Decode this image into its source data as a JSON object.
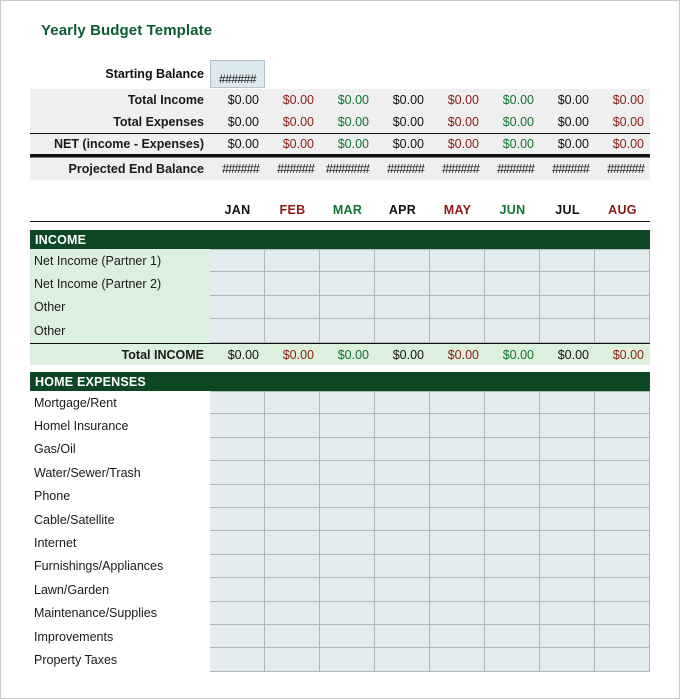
{
  "title": "Yearly Budget Template",
  "colors": {
    "title_green": "#0d5c33",
    "section_bar": "#0d4723",
    "entry_fill": "#e3ebef",
    "total_fill": "#ddf0dd",
    "summary_fill": "#efefef",
    "month_black": "#111111",
    "month_red": "#8c1b15",
    "month_green": "#117331"
  },
  "months": [
    {
      "label": "JAN",
      "tone": "black"
    },
    {
      "label": "FEB",
      "tone": "red"
    },
    {
      "label": "MAR",
      "tone": "green"
    },
    {
      "label": "APR",
      "tone": "black"
    },
    {
      "label": "MAY",
      "tone": "red"
    },
    {
      "label": "JUN",
      "tone": "green"
    },
    {
      "label": "JUL",
      "tone": "black"
    },
    {
      "label": "AUG",
      "tone": "red"
    }
  ],
  "starting_balance": {
    "label": "Starting Balance",
    "value": "######"
  },
  "summary": {
    "rows": [
      {
        "label": "Total Income",
        "values": [
          "$0.00",
          "$0.00",
          "$0.00",
          "$0.00",
          "$0.00",
          "$0.00",
          "$0.00",
          "$0.00"
        ]
      },
      {
        "label": "Total Expenses",
        "values": [
          "$0.00",
          "$0.00",
          "$0.00",
          "$0.00",
          "$0.00",
          "$0.00",
          "$0.00",
          "$0.00"
        ]
      },
      {
        "label": "NET (income - Expenses)",
        "values": [
          "$0.00",
          "$0.00",
          "$0.00",
          "$0.00",
          "$0.00",
          "$0.00",
          "$0.00",
          "$0.00"
        ]
      },
      {
        "label": "Projected End Balance",
        "values": [
          "######",
          "######",
          "#######",
          "######",
          "######",
          "######",
          "######",
          "######"
        ]
      }
    ]
  },
  "income": {
    "section_label": "INCOME",
    "rows": [
      "Net Income  (Partner 1)",
      "Net Income (Partner 2)",
      "Other",
      "Other"
    ],
    "total_label": "Total INCOME",
    "total_values": [
      "$0.00",
      "$0.00",
      "$0.00",
      "$0.00",
      "$0.00",
      "$0.00",
      "$0.00",
      "$0.00"
    ]
  },
  "home_expenses": {
    "section_label": "HOME EXPENSES",
    "rows": [
      "Mortgage/Rent",
      "Homel Insurance",
      "Gas/Oil",
      "Water/Sewer/Trash",
      "Phone",
      "Cable/Satellite",
      "Internet",
      "Furnishings/Appliances",
      "Lawn/Garden",
      "Maintenance/Supplies",
      "Improvements",
      "Property Taxes"
    ]
  }
}
